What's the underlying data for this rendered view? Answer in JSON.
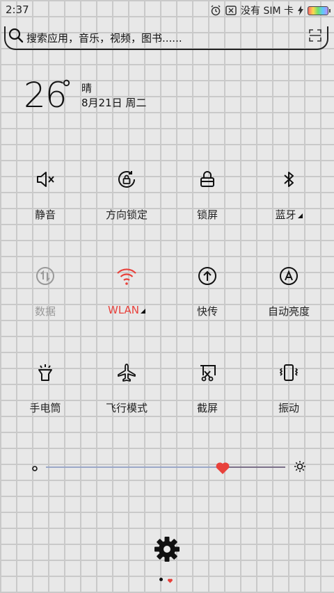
{
  "status_bar": {
    "time": "2:37",
    "carrier": "没有 SIM 卡"
  },
  "search": {
    "placeholder": "搜索应用，音乐，视频，图书......"
  },
  "weather": {
    "temperature": "26",
    "degree": "°",
    "condition": "晴",
    "date": "8月21日 周二"
  },
  "toggles": [
    {
      "label": "静音",
      "icon": "mute-icon"
    },
    {
      "label": "方向锁定",
      "icon": "rotation-lock-icon"
    },
    {
      "label": "锁屏",
      "icon": "lock-icon"
    },
    {
      "label": "蓝牙",
      "icon": "bluetooth-icon"
    },
    {
      "label": "数据",
      "icon": "data-icon"
    },
    {
      "label": "WLAN",
      "icon": "wifi-icon"
    },
    {
      "label": "快传",
      "icon": "share-icon"
    },
    {
      "label": "自动亮度",
      "icon": "auto-brightness-icon"
    },
    {
      "label": "手电筒",
      "icon": "flashlight-icon"
    },
    {
      "label": "飞行模式",
      "icon": "airplane-icon"
    },
    {
      "label": "截屏",
      "icon": "screenshot-icon"
    },
    {
      "label": "振动",
      "icon": "vibrate-icon"
    }
  ],
  "brightness": {
    "level_fraction": 0.7
  },
  "colors": {
    "accent_red": "#e8413b"
  }
}
